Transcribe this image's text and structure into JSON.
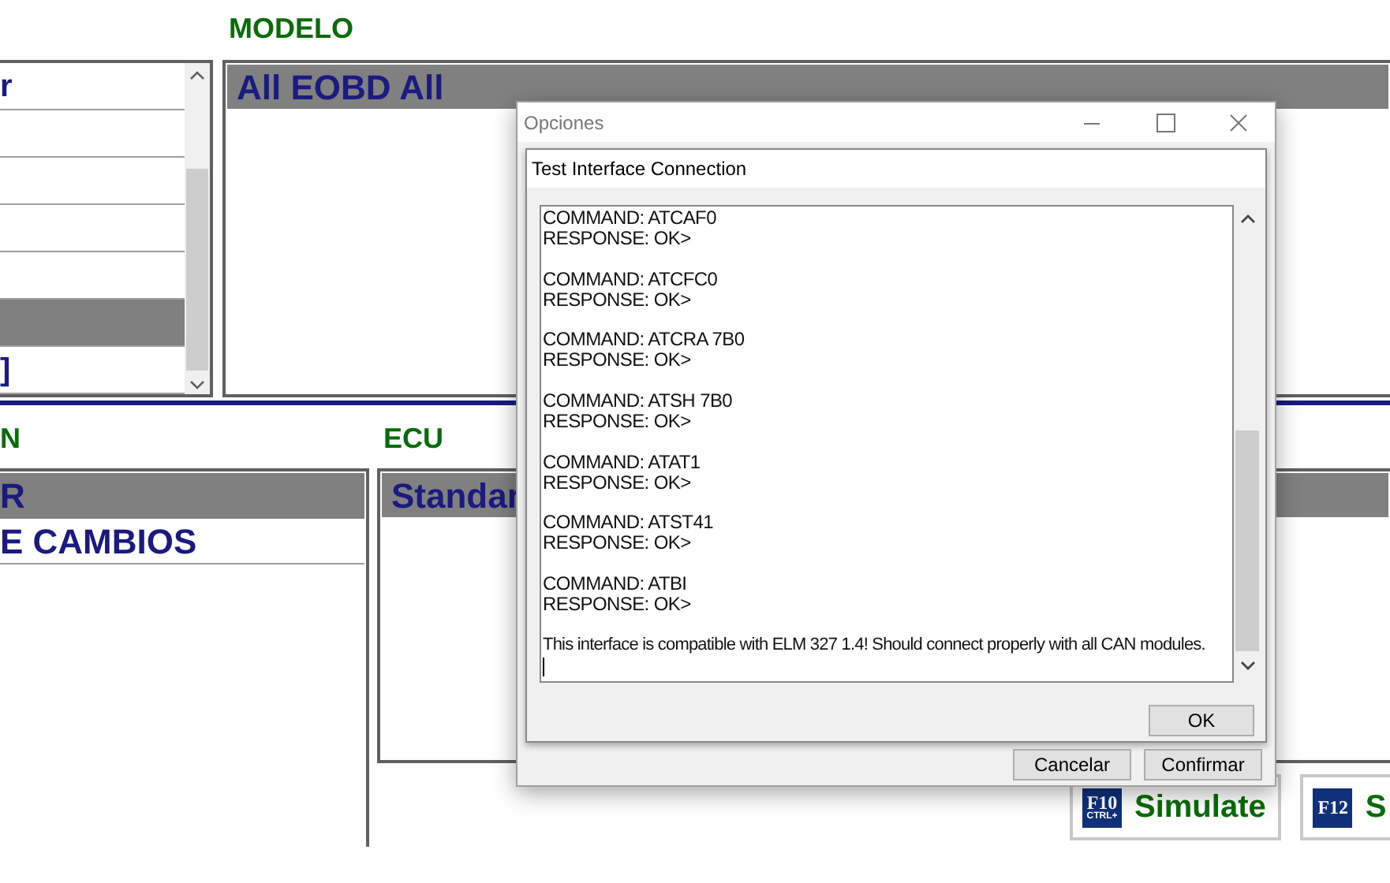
{
  "model_label": "MODELO",
  "left_list": {
    "items": [
      {
        "text": "r",
        "selected": false
      },
      {
        "selected": false
      },
      {
        "selected": false
      },
      {
        "selected": false
      },
      {
        "selected": false
      },
      {
        "selected": true
      },
      {
        "text": "]",
        "selected": false
      }
    ]
  },
  "model_list": {
    "items": [
      {
        "text": "All EOBD All",
        "selected": true
      }
    ]
  },
  "section_label": "N",
  "ecu_label": "ECU",
  "left_panel": {
    "items": [
      {
        "text": "R",
        "selected": true
      },
      {
        "text": "E CAMBIOS",
        "selected": false
      }
    ]
  },
  "ecu_list": {
    "items": [
      {
        "text": "Standar",
        "selected": true
      }
    ]
  },
  "function_buttons": [
    {
      "key": "F10",
      "modifier": "CTRL+",
      "label": "Simulate"
    },
    {
      "key": "F12",
      "label": "S"
    }
  ],
  "dialog": {
    "title": "Opciones",
    "heading": "Test Interface Connection",
    "log": [
      {
        "kind": "exchange",
        "command": "COMMAND: ATCAF0",
        "response": "RESPONSE: OK>"
      },
      {
        "kind": "exchange",
        "command": "COMMAND: ATCFC0",
        "response": "RESPONSE: OK>"
      },
      {
        "kind": "exchange",
        "command": "COMMAND: ATCRA 7B0",
        "response": "RESPONSE: OK>"
      },
      {
        "kind": "exchange",
        "command": "COMMAND: ATSH 7B0",
        "response": "RESPONSE: OK>"
      },
      {
        "kind": "exchange",
        "command": "COMMAND: ATAT1",
        "response": "RESPONSE: OK>"
      },
      {
        "kind": "exchange",
        "command": "COMMAND: ATST41",
        "response": "RESPONSE: OK>"
      },
      {
        "kind": "exchange",
        "command": "COMMAND: ATBI",
        "response": "RESPONSE: OK>"
      },
      {
        "kind": "message",
        "text": "This interface is compatible with ELM 327 1.4! Should connect properly with all CAN modules."
      }
    ],
    "inner_button": "OK",
    "buttons": [
      "Cancelar",
      "Confirmar"
    ]
  }
}
